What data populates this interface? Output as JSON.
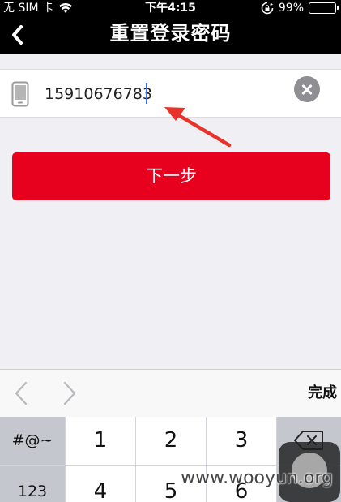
{
  "status_bar": {
    "carrier": "无 SIM 卡",
    "time": "下午4:15",
    "battery": "99%",
    "battery_level": 0.99
  },
  "nav": {
    "title": "重置登录密码"
  },
  "form": {
    "phone_value": "15910676783"
  },
  "next_button": {
    "label": "下一步"
  },
  "accessory": {
    "done_label": "完成"
  },
  "keyboard": {
    "keys": [
      "#@~",
      "1",
      "2",
      "3",
      "123",
      "4",
      "5",
      "6"
    ]
  },
  "watermark": {
    "text": "www.wooyun.org"
  },
  "colors": {
    "primary_button": "#e8001f",
    "arrow": "#e8332b",
    "top_bar": "#000000",
    "background": "#efeff4"
  }
}
